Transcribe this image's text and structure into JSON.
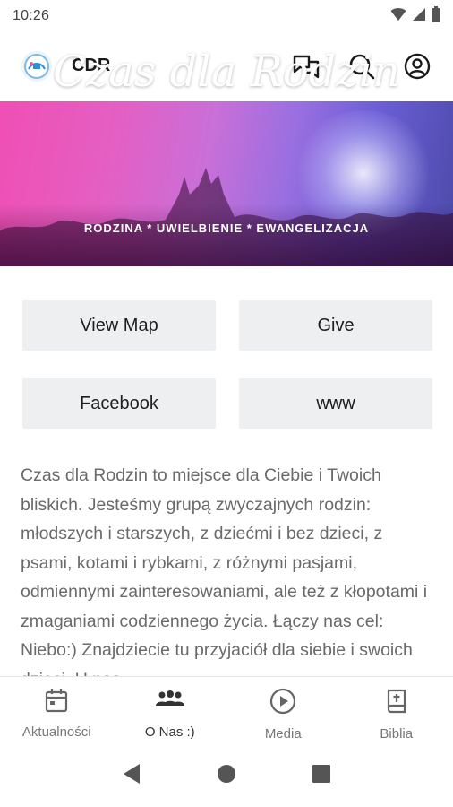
{
  "status_bar": {
    "time": "10:26",
    "icons": [
      "wifi-icon",
      "cellular-signal-icon",
      "battery-icon"
    ]
  },
  "app_bar": {
    "logo_icon": "cdr-logo-icon",
    "title": "CDR",
    "actions": [
      "chat-icon",
      "search-icon",
      "account-icon"
    ]
  },
  "hero": {
    "title": "Czas dla Rodzin",
    "subtitle": "RODZINA * UWIELBIENIE * EWANGELIZACJA"
  },
  "buttons": {
    "view_map": "View Map",
    "give": "Give",
    "facebook": "Facebook",
    "www": "www"
  },
  "description": "Czas dla Rodzin to miejsce dla Ciebie i Twoich bliskich. Jesteśmy grupą zwyczajnych rodzin: młodszych i starszych, z dziećmi i bez dzieci, z psami, kotami i rybkami, z różnymi pasjami, odmiennymi zainteresowaniami, ale też z kłopotami i zmaganiami codziennego życia. Łączy nas cel: Niebo:) Znajdziecie tu przyjaciół dla siebie i swoich dzieci. U nas",
  "bottom_nav": [
    {
      "label": "Aktualności",
      "icon": "calendar-icon",
      "active": false
    },
    {
      "label": "O Nas :)",
      "icon": "group-icon",
      "active": true
    },
    {
      "label": "Media",
      "icon": "play-circle-icon",
      "active": false
    },
    {
      "label": "Biblia",
      "icon": "bible-icon",
      "active": false
    }
  ],
  "system_nav": [
    "back-icon",
    "home-icon",
    "recents-icon"
  ],
  "colors": {
    "button_bg": "#eeeff1",
    "text_secondary": "#6a6a6a",
    "hero_pink": "#f04fb4",
    "hero_violet": "#6d5fd8"
  }
}
